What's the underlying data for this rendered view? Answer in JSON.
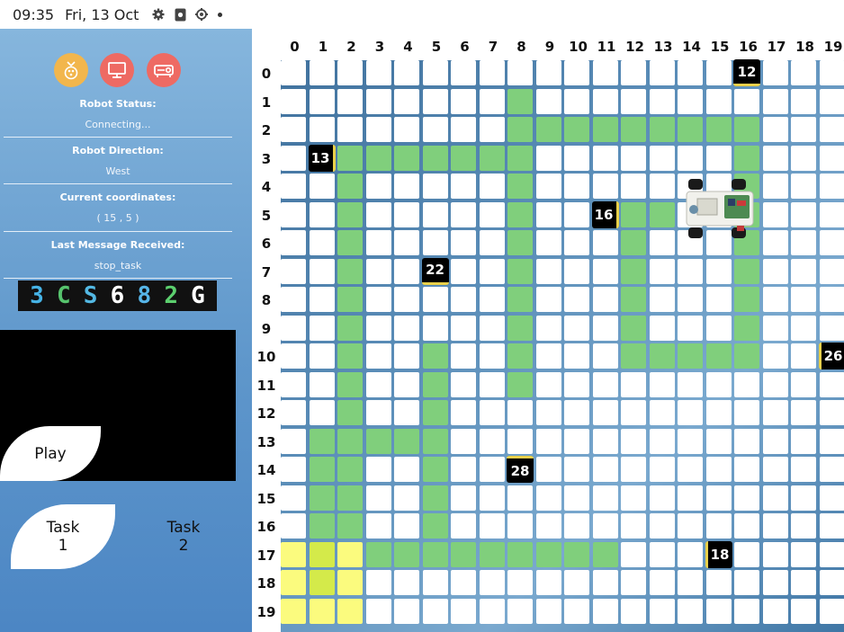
{
  "status_bar": {
    "time": "09:35",
    "date": "Fri, 13 Oct",
    "icons": [
      "settings-gear-icon",
      "sim-card-icon",
      "settings-cog-icon",
      "notification-dot-icon"
    ]
  },
  "sidebar": {
    "buttons": [
      {
        "name": "raspberry-pi-button",
        "icon": "raspberry-icon",
        "color": "#f2b64c"
      },
      {
        "name": "monitor-button",
        "icon": "monitor-icon",
        "color": "#ee6a63"
      },
      {
        "name": "projector-button",
        "icon": "projector-icon",
        "color": "#ee6a63"
      }
    ],
    "robot_status_label": "Robot Status:",
    "robot_status_value": "Connecting...",
    "robot_direction_label": "Robot Direction:",
    "robot_direction_value": "West",
    "coordinates_label": "Current coordinates:",
    "coordinates_value": "( 15 , 5 )",
    "last_message_label": "Last Message Received:",
    "last_message_value": "stop_task",
    "captcha": [
      {
        "char": "3",
        "color": "#46b3e6"
      },
      {
        "char": "C",
        "color": "#56c36d"
      },
      {
        "char": "S",
        "color": "#53b8e3"
      },
      {
        "char": "6",
        "color": "#ffffff"
      },
      {
        "char": "8",
        "color": "#56b5e8"
      },
      {
        "char": "2",
        "color": "#5ccf6e"
      },
      {
        "char": "G",
        "color": "#ffffff"
      }
    ],
    "play_label": "Play",
    "task1_label": "Task\n1",
    "task2_label": "Task\n2"
  },
  "grid": {
    "columns": [
      "0",
      "1",
      "2",
      "3",
      "4",
      "5",
      "6",
      "7",
      "8",
      "9",
      "10",
      "11",
      "12",
      "13",
      "14",
      "15",
      "16",
      "17",
      "18",
      "19"
    ],
    "rows": [
      "0",
      "1",
      "2",
      "3",
      "4",
      "5",
      "6",
      "7",
      "8",
      "9",
      "10",
      "11",
      "12",
      "13",
      "14",
      "15",
      "16",
      "17",
      "18",
      "19"
    ],
    "path_color": "#80cf7c",
    "start_color": "#fbfb7e",
    "start_highlight_color": "#d4ea4a",
    "path_cells": [
      [
        1,
        8
      ],
      [
        2,
        8
      ],
      [
        2,
        9
      ],
      [
        2,
        10
      ],
      [
        2,
        11
      ],
      [
        2,
        12
      ],
      [
        2,
        13
      ],
      [
        2,
        14
      ],
      [
        2,
        15
      ],
      [
        2,
        16
      ],
      [
        3,
        2
      ],
      [
        3,
        3
      ],
      [
        3,
        4
      ],
      [
        3,
        5
      ],
      [
        3,
        6
      ],
      [
        3,
        7
      ],
      [
        3,
        8
      ],
      [
        3,
        16
      ],
      [
        4,
        2
      ],
      [
        4,
        8
      ],
      [
        4,
        16
      ],
      [
        5,
        2
      ],
      [
        5,
        8
      ],
      [
        5,
        12
      ],
      [
        5,
        13
      ],
      [
        5,
        16
      ],
      [
        6,
        2
      ],
      [
        6,
        8
      ],
      [
        6,
        12
      ],
      [
        6,
        16
      ],
      [
        7,
        2
      ],
      [
        7,
        8
      ],
      [
        7,
        12
      ],
      [
        7,
        16
      ],
      [
        8,
        2
      ],
      [
        8,
        8
      ],
      [
        8,
        12
      ],
      [
        8,
        16
      ],
      [
        9,
        2
      ],
      [
        9,
        8
      ],
      [
        9,
        12
      ],
      [
        9,
        16
      ],
      [
        10,
        2
      ],
      [
        10,
        5
      ],
      [
        10,
        8
      ],
      [
        10,
        12
      ],
      [
        10,
        13
      ],
      [
        10,
        14
      ],
      [
        10,
        15
      ],
      [
        10,
        16
      ],
      [
        11,
        2
      ],
      [
        11,
        5
      ],
      [
        11,
        8
      ],
      [
        12,
        2
      ],
      [
        12,
        5
      ],
      [
        13,
        1
      ],
      [
        13,
        2
      ],
      [
        13,
        3
      ],
      [
        13,
        4
      ],
      [
        13,
        5
      ],
      [
        14,
        1
      ],
      [
        14,
        2
      ],
      [
        14,
        5
      ],
      [
        15,
        1
      ],
      [
        15,
        2
      ],
      [
        15,
        5
      ],
      [
        16,
        1
      ],
      [
        16,
        2
      ],
      [
        16,
        5
      ],
      [
        17,
        3
      ],
      [
        17,
        4
      ],
      [
        17,
        5
      ],
      [
        17,
        6
      ],
      [
        17,
        7
      ],
      [
        17,
        8
      ],
      [
        17,
        9
      ],
      [
        17,
        10
      ],
      [
        17,
        11
      ]
    ],
    "start_cells": [
      [
        17,
        0
      ],
      [
        17,
        1
      ],
      [
        17,
        2
      ],
      [
        18,
        0
      ],
      [
        18,
        1
      ],
      [
        18,
        2
      ],
      [
        19,
        0
      ],
      [
        19,
        1
      ],
      [
        19,
        2
      ]
    ],
    "start_highlight_cells": [
      [
        17,
        1
      ],
      [
        18,
        1
      ]
    ],
    "obstacles": [
      {
        "id": "12",
        "row": 0,
        "col": 16,
        "face": "south"
      },
      {
        "id": "13",
        "row": 3,
        "col": 1,
        "face": "east"
      },
      {
        "id": "16",
        "row": 5,
        "col": 11,
        "face": "east"
      },
      {
        "id": "22",
        "row": 7,
        "col": 5,
        "face": "south"
      },
      {
        "id": "26",
        "row": 10,
        "col": 19,
        "face": "west"
      },
      {
        "id": "28",
        "row": 14,
        "col": 8,
        "face": "north"
      },
      {
        "id": "18",
        "row": 17,
        "col": 15,
        "face": "west"
      }
    ],
    "face_color": "#e8d04a",
    "robot": {
      "row": 5,
      "col": 15,
      "direction": "West"
    }
  }
}
